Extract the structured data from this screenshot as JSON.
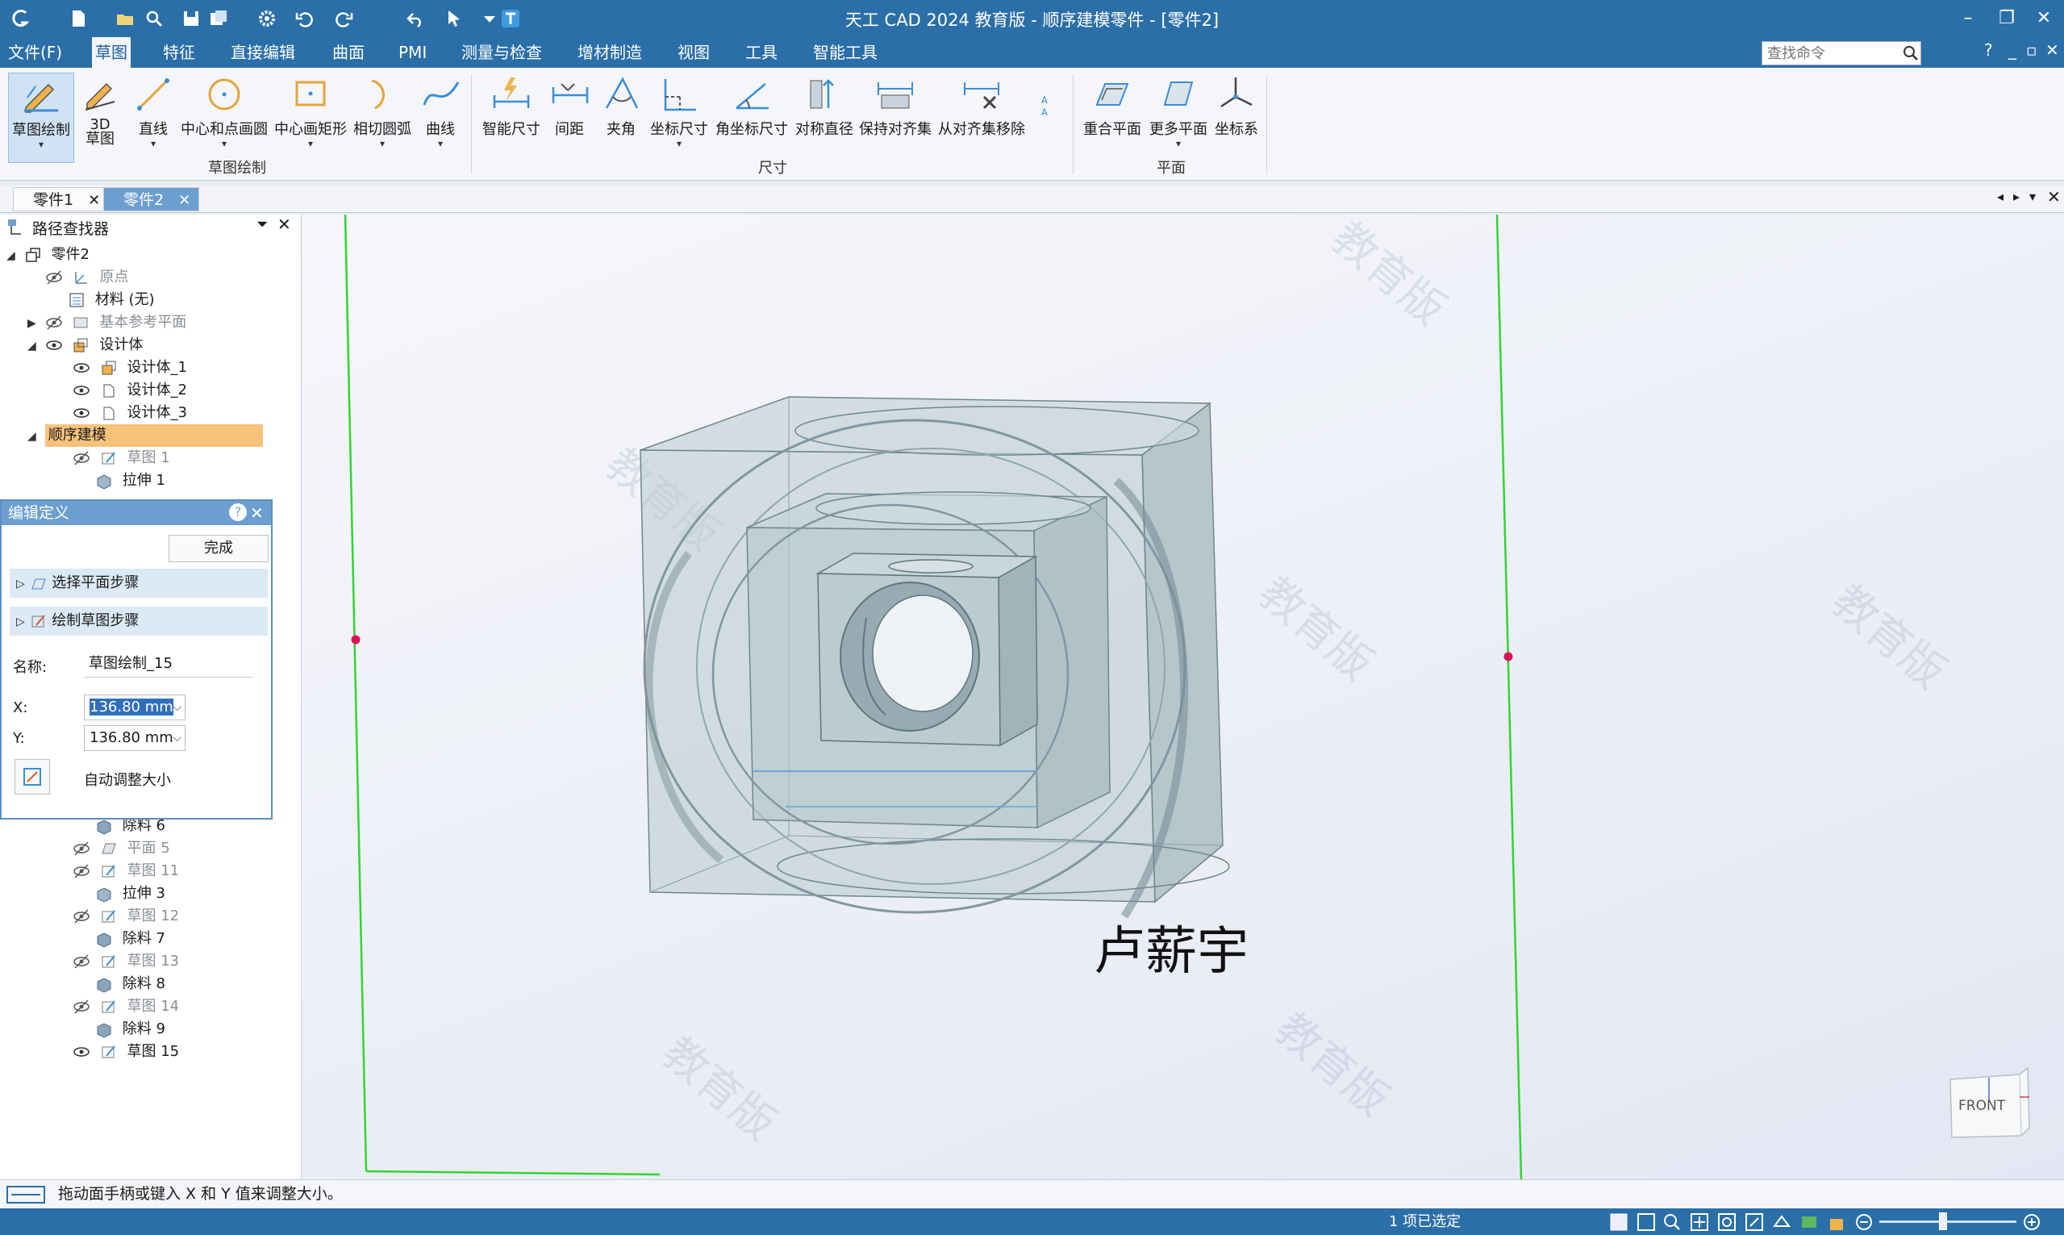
{
  "app": {
    "title": "天工 CAD 2024 教育版 - 顺序建模零件 - [零件2]"
  },
  "menu": {
    "items": [
      "文件(F)",
      "草图",
      "特征",
      "直接编辑",
      "曲面",
      "PMI",
      "测量与检查",
      "增材制造",
      "视图",
      "工具",
      "智能工具"
    ],
    "active": "草图",
    "search_placeholder": "查找命令",
    "help": "?"
  },
  "ribbon": {
    "sketch_group": {
      "label": "草图绘制",
      "buttons": [
        "草图绘制",
        "3D\n草图",
        "直线",
        "中心和点画圆",
        "中心画矩形",
        "相切圆弧",
        "曲线"
      ]
    },
    "dimension_group": {
      "label": "尺寸",
      "buttons": [
        "智能尺寸",
        "间距",
        "夹角",
        "坐标尺寸",
        "角坐标尺寸",
        "对称直径",
        "保持对齐集",
        "从对齐集移除"
      ]
    },
    "plane_group": {
      "label": "平面",
      "buttons": [
        "重合平面",
        "更多平面",
        "坐标系"
      ]
    }
  },
  "tabs": [
    {
      "label": "零件1",
      "active": false
    },
    {
      "label": "零件2",
      "active": true
    }
  ],
  "pathfinder": {
    "title": "路径查找器",
    "root": "零件2",
    "rows": [
      {
        "label": "原点",
        "dim": true
      },
      {
        "label": "材料 (无)",
        "dim": false
      },
      {
        "label": "基本参考平面",
        "dim": true
      },
      {
        "label": "设计体",
        "dim": false
      },
      {
        "label": "设计体_1",
        "dim": false
      },
      {
        "label": "设计体_2",
        "dim": false
      },
      {
        "label": "设计体_3",
        "dim": false
      },
      {
        "label": "顺序建模",
        "dim": false
      },
      {
        "label": "草图 1",
        "dim": true
      },
      {
        "label": "拉伸 1",
        "dim": false
      }
    ],
    "lower_rows": [
      {
        "label": "除料 6",
        "dim": false
      },
      {
        "label": "平面 5",
        "dim": true
      },
      {
        "label": "草图 11",
        "dim": true
      },
      {
        "label": "拉伸 3",
        "dim": false
      },
      {
        "label": "草图 12",
        "dim": true
      },
      {
        "label": "除料 7",
        "dim": false
      },
      {
        "label": "草图 13",
        "dim": true
      },
      {
        "label": "除料 8",
        "dim": false
      },
      {
        "label": "草图 14",
        "dim": true
      },
      {
        "label": "除料 9",
        "dim": false
      },
      {
        "label": "草图 15",
        "dim": false
      }
    ]
  },
  "edit_definition": {
    "title": "编辑定义",
    "help": "?",
    "done_label": "完成",
    "step1": "选择平面步骤",
    "step2": "绘制草图步骤",
    "name_label": "名称:",
    "name_value": "草图绘制_15",
    "x_label": "X:",
    "x_value": "136.80 mm",
    "y_label": "Y:",
    "y_value": "136.80 mm",
    "auto_resize_label": "自动调整大小"
  },
  "viewport": {
    "signature": "卢薪宇",
    "watermark": "教育版",
    "viewcube_label": "FRONT"
  },
  "status": {
    "prompt": "拖动面手柄或键入 X 和 Y 值来调整大小。",
    "selection": "1 项已选定"
  },
  "colors": {
    "titlebar": "#2b6fa8",
    "accent": "#6c9fd0",
    "sketch_line": "#2fd62f",
    "handle": "#e0105a",
    "body_fill": "#9fb6bd"
  }
}
